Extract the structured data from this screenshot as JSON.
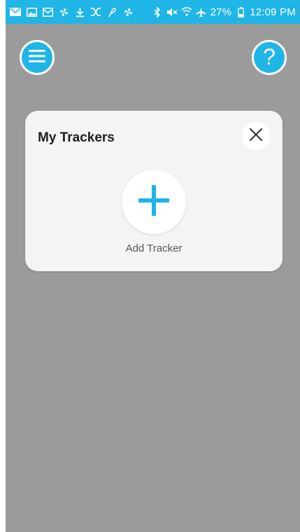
{
  "status_bar": {
    "battery_percent": "27%",
    "time": "12:09 PM",
    "left_icons": [
      "mail-icon",
      "image-icon",
      "email-icon",
      "pinwheel-icon",
      "download-icon",
      "shuffle-icon",
      "feather-icon",
      "pinwheel-icon"
    ],
    "right_icons": [
      "bluetooth-icon",
      "mute-icon",
      "wifi-icon",
      "airplane-icon",
      "battery-icon"
    ]
  },
  "header": {
    "menu_icon": "hamburger-icon",
    "help_label": "?"
  },
  "card": {
    "title": "My Trackers",
    "close_icon": "close-icon",
    "add_icon": "plus-icon",
    "add_label": "Add Tracker"
  },
  "colors": {
    "accent": "#1fb5e6",
    "background": "#9b9b9b",
    "card": "#f4f4f4",
    "title_text": "#1e1e1e",
    "label_text": "#555555"
  }
}
